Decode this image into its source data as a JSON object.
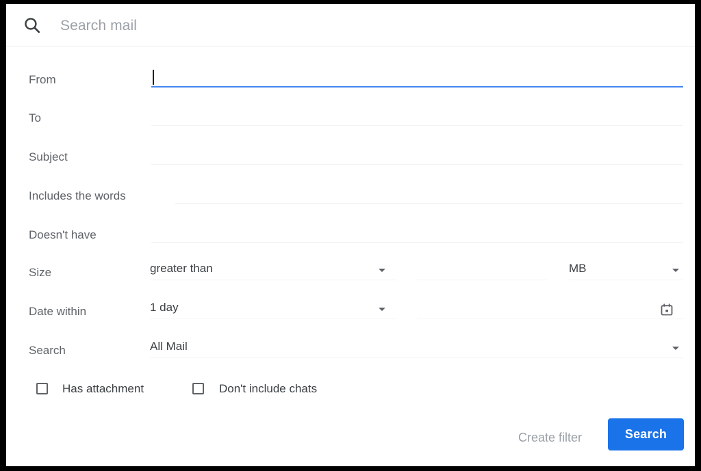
{
  "search_bar": {
    "icon": "search-icon",
    "placeholder": "Search mail",
    "value": ""
  },
  "colors": {
    "accent": "#1a73e8",
    "focus_underline": "#4285f4",
    "label_text": "#5f6368",
    "value_text": "#3c4043",
    "placeholder_text": "#9aa0a6",
    "field_underline": "#f1f3f4",
    "frame": "#000000",
    "panel": "#ffffff"
  },
  "fields": {
    "from": {
      "label": "From",
      "value": "",
      "focused": true
    },
    "to": {
      "label": "To",
      "value": ""
    },
    "subject": {
      "label": "Subject",
      "value": ""
    },
    "includes": {
      "label": "Includes the words",
      "value": ""
    },
    "doesnt_have": {
      "label": "Doesn't have",
      "value": ""
    },
    "size": {
      "label": "Size",
      "operator_value": "greater than",
      "amount_value": "",
      "unit_value": "MB"
    },
    "date_within": {
      "label": "Date within",
      "range_value": "1 day",
      "date_value": "",
      "calendar_icon": "calendar-icon"
    },
    "search_scope": {
      "label": "Search",
      "value": "All Mail"
    }
  },
  "checkboxes": [
    {
      "label": "Has attachment",
      "checked": false
    },
    {
      "label": "Don't include chats",
      "checked": false
    }
  ],
  "footer": {
    "create_filter_label": "Create filter",
    "search_label": "Search"
  }
}
